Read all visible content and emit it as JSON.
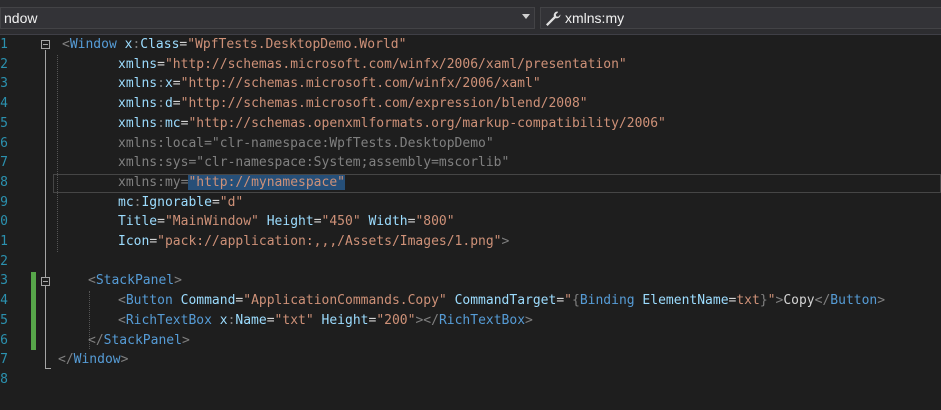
{
  "navbar": {
    "left_text": "ndow",
    "right_text": "xmlns:my",
    "right_icon": "wrench-icon"
  },
  "editor": {
    "lines": [
      {
        "num": "1",
        "tokens": [
          [
            "dim",
            "<"
          ],
          [
            "tag",
            "Window"
          ],
          [
            "attr",
            " x"
          ],
          [
            "dim",
            ":"
          ],
          [
            "attr",
            "Class"
          ],
          [
            "eq",
            "="
          ],
          [
            "val",
            "\"WpfTests.DesktopDemo.World\""
          ]
        ]
      },
      {
        "num": "2",
        "tokens": [
          [
            "attr",
            "xmlns"
          ],
          [
            "eq",
            "="
          ],
          [
            "val",
            "\"http://schemas.microsoft.com/winfx/2006/xaml/presentation\""
          ]
        ]
      },
      {
        "num": "3",
        "tokens": [
          [
            "attr",
            "xmlns"
          ],
          [
            "dim",
            ":"
          ],
          [
            "attr",
            "x"
          ],
          [
            "eq",
            "="
          ],
          [
            "val",
            "\"http://schemas.microsoft.com/winfx/2006/xaml\""
          ]
        ]
      },
      {
        "num": "4",
        "tokens": [
          [
            "attr",
            "xmlns"
          ],
          [
            "dim",
            ":"
          ],
          [
            "attr",
            "d"
          ],
          [
            "eq",
            "="
          ],
          [
            "val",
            "\"http://schemas.microsoft.com/expression/blend/2008\""
          ]
        ]
      },
      {
        "num": "5",
        "tokens": [
          [
            "attr",
            "xmlns"
          ],
          [
            "dim",
            ":"
          ],
          [
            "attr",
            "mc"
          ],
          [
            "eq",
            "="
          ],
          [
            "val",
            "\"http://schemas.openxmlformats.org/markup-compatibility/2006\""
          ]
        ]
      },
      {
        "num": "6",
        "tokens": [
          [
            "dim",
            "xmlns:local=\"clr-namespace:WpfTests.DesktopDemo\""
          ]
        ]
      },
      {
        "num": "7",
        "tokens": [
          [
            "dim",
            "xmlns:sys=\"clr-namespace:System;assembly=mscorlib\""
          ]
        ]
      },
      {
        "num": "8",
        "tokens": [
          [
            "dim",
            "xmlns:my="
          ],
          [
            "val",
            "\"http://mynamespace\""
          ]
        ]
      },
      {
        "num": "9",
        "tokens": [
          [
            "attr",
            "mc"
          ],
          [
            "dim",
            ":"
          ],
          [
            "attr",
            "Ignorable"
          ],
          [
            "eq",
            "="
          ],
          [
            "val",
            "\"d\""
          ]
        ]
      },
      {
        "num": "0",
        "tokens": [
          [
            "attr",
            "Title"
          ],
          [
            "eq",
            "="
          ],
          [
            "val",
            "\"MainWindow\""
          ],
          [
            "attr",
            " Height"
          ],
          [
            "eq",
            "="
          ],
          [
            "val",
            "\"450\""
          ],
          [
            "attr",
            " Width"
          ],
          [
            "eq",
            "="
          ],
          [
            "val",
            "\"800\""
          ]
        ]
      },
      {
        "num": "1",
        "tokens": [
          [
            "attr",
            "Icon"
          ],
          [
            "eq",
            "="
          ],
          [
            "val",
            "\"pack://application:,,,/Assets/Images/1.png\""
          ],
          [
            "dim",
            ">"
          ]
        ]
      },
      {
        "num": "2",
        "tokens": []
      },
      {
        "num": "3",
        "tokens": [
          [
            "dim",
            "<"
          ],
          [
            "tag",
            "StackPanel"
          ],
          [
            "dim",
            ">"
          ]
        ]
      },
      {
        "num": "4",
        "tokens": [
          [
            "dim",
            "<"
          ],
          [
            "tag",
            "Button"
          ],
          [
            "attr",
            " Command"
          ],
          [
            "eq",
            "="
          ],
          [
            "val",
            "\"ApplicationCommands.Copy\""
          ],
          [
            "attr",
            " CommandTarget"
          ],
          [
            "eq",
            "="
          ],
          [
            "val",
            "\""
          ],
          [
            "dim",
            "{"
          ],
          [
            "tag",
            "Binding"
          ],
          [
            "attr",
            " ElementName"
          ],
          [
            "eq",
            "="
          ],
          [
            "val",
            "txt"
          ],
          [
            "dim",
            "}"
          ],
          [
            "val",
            "\""
          ],
          [
            "dim",
            ">"
          ],
          [
            "txt",
            "Copy"
          ],
          [
            "dim",
            "</"
          ],
          [
            "tag",
            "Button"
          ],
          [
            "dim",
            ">"
          ]
        ]
      },
      {
        "num": "5",
        "tokens": [
          [
            "dim",
            "<"
          ],
          [
            "tag",
            "RichTextBox"
          ],
          [
            "attr",
            " x"
          ],
          [
            "dim",
            ":"
          ],
          [
            "attr",
            "Name"
          ],
          [
            "eq",
            "="
          ],
          [
            "val",
            "\"txt\""
          ],
          [
            "attr",
            " Height"
          ],
          [
            "eq",
            "="
          ],
          [
            "val",
            "\"200\""
          ],
          [
            "dim",
            "></"
          ],
          [
            "tag",
            "RichTextBox"
          ],
          [
            "dim",
            ">"
          ]
        ]
      },
      {
        "num": "6",
        "tokens": [
          [
            "dim",
            "</"
          ],
          [
            "tag",
            "StackPanel"
          ],
          [
            "dim",
            ">"
          ]
        ]
      },
      {
        "num": "7",
        "tokens": [
          [
            "dim",
            "</"
          ],
          [
            "tag",
            "Window"
          ],
          [
            "dim",
            ">"
          ]
        ]
      },
      {
        "num": "8",
        "tokens": []
      }
    ]
  },
  "colors": {
    "background": "#1e1e1e",
    "tag": "#569cd6",
    "attribute": "#9cdcfe",
    "value": "#ce9178",
    "punctuation": "#808080",
    "line_number": "#2b91af",
    "change_bar": "#57a64a"
  }
}
